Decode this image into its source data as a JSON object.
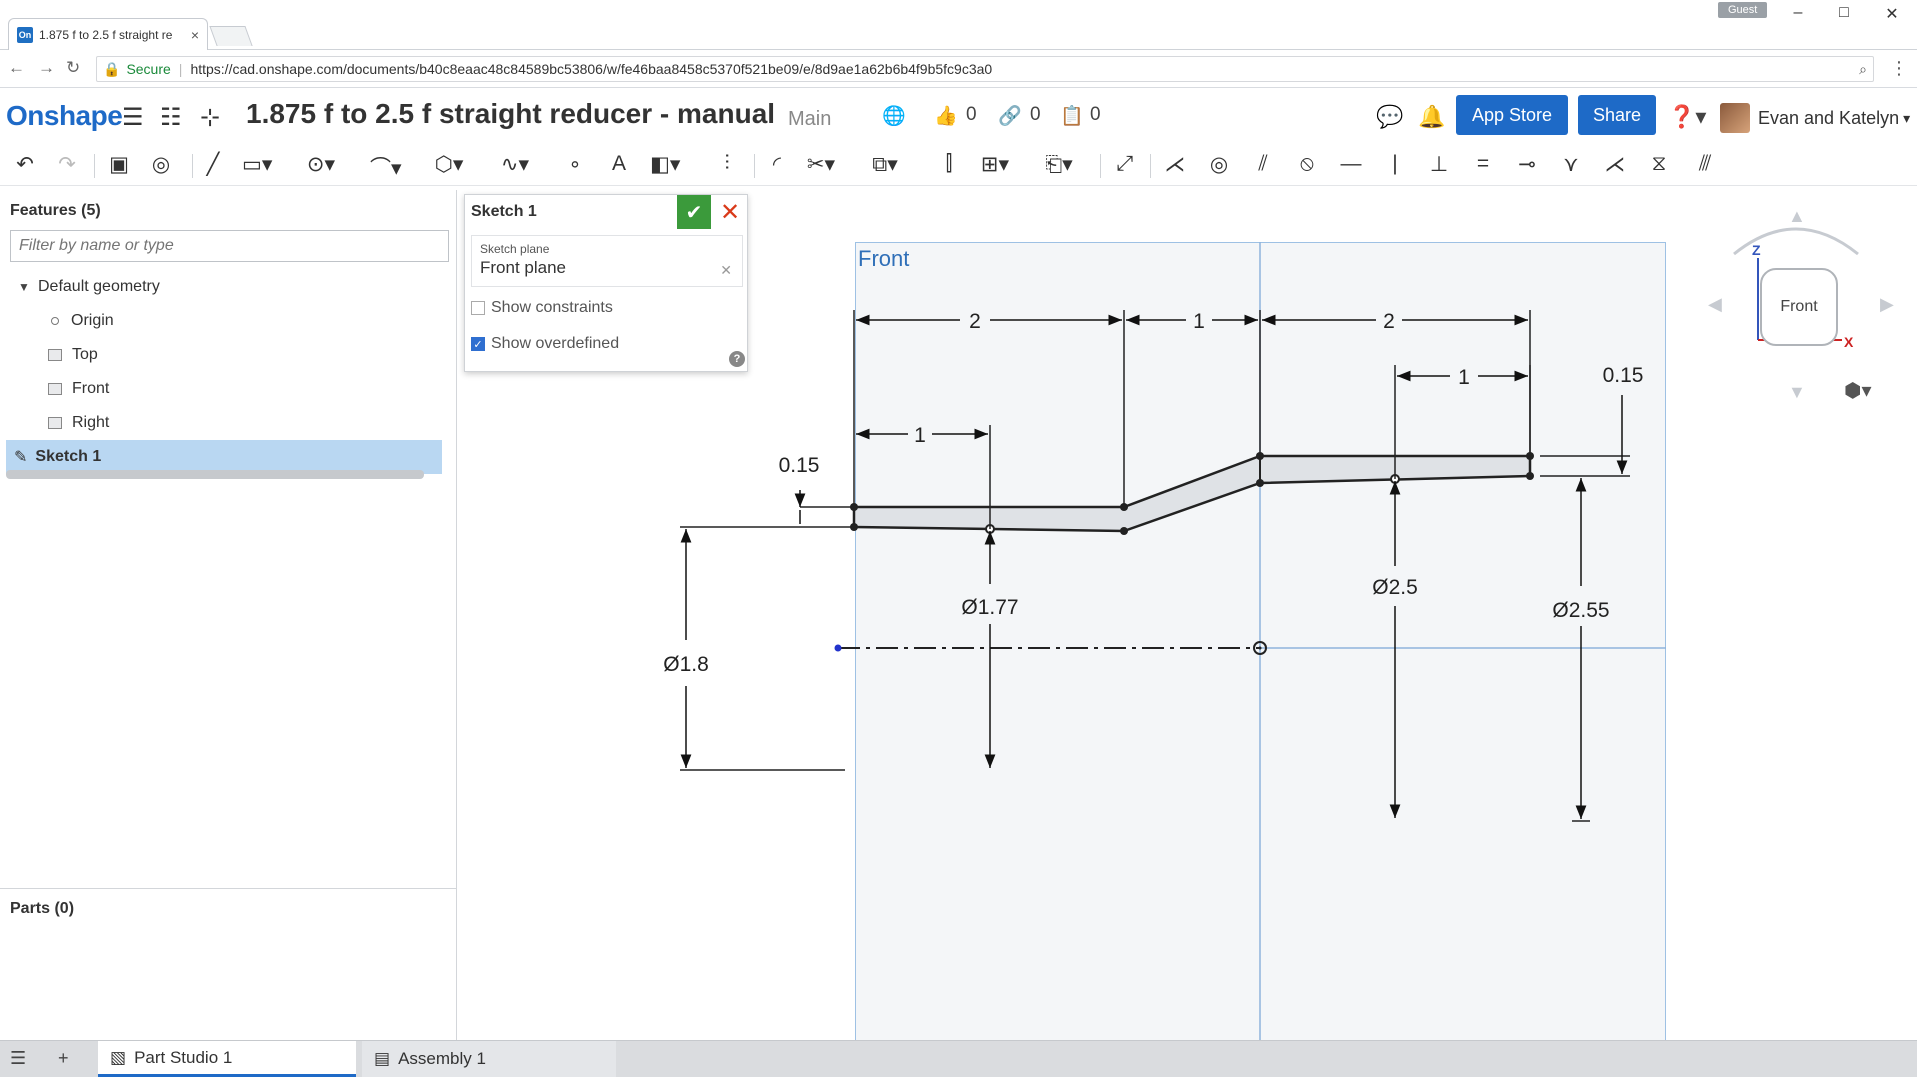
{
  "browser": {
    "tab_title": "1.875 f to 2.5 f straight re",
    "tab_close": "×",
    "guest_label": "Guest",
    "secure_label": "Secure",
    "url": "https://cad.onshape.com/documents/b40c8eaac48c84589bc53806/w/fe46baa8458c5370f521be09/e/8d9ae1a62b6b4f9b5fc9c3a0"
  },
  "header": {
    "logo": "Onshape",
    "document_title": "1.875 f to 2.5 f straight reducer - manual",
    "workspace": "Main",
    "likes": "0",
    "links": "0",
    "versions": "0",
    "app_store_label": "App Store",
    "share_label": "Share",
    "user_name": "Evan and Katelyn"
  },
  "features": {
    "title": "Features (5)",
    "filter_placeholder": "Filter by name or type",
    "default_geometry": "Default geometry",
    "items": [
      {
        "label": "Origin"
      },
      {
        "label": "Top"
      },
      {
        "label": "Front"
      },
      {
        "label": "Right"
      }
    ],
    "selected_item": "Sketch 1",
    "parts_title": "Parts (0)"
  },
  "sketch_dialog": {
    "title": "Sketch 1",
    "plane_label": "Sketch plane",
    "plane_value": "Front plane",
    "show_constraints": {
      "label": "Show constraints",
      "checked": false
    },
    "show_overdefined": {
      "label": "Show overdefined",
      "checked": true
    },
    "help": "?"
  },
  "viewport": {
    "plane_name": "Front",
    "view_cube_label": "Front",
    "axis_z": "Z",
    "axis_x": "X"
  },
  "dimensions": {
    "top_left_2": "2",
    "top_mid_1": "1",
    "top_right_2": "2",
    "right_1": "1",
    "left_1": "1",
    "left_thickness": "0.15",
    "right_thickness": "0.15",
    "dia_1_8": "Ø1.8",
    "dia_1_77": "Ø1.77",
    "dia_2_5": "Ø2.5",
    "dia_2_55": "Ø2.55"
  },
  "bottom_tabs": [
    {
      "label": "Part Studio 1",
      "active": true
    },
    {
      "label": "Assembly 1",
      "active": false
    }
  ],
  "colors": {
    "brand": "#1e6ac7",
    "ok_green": "#3b9a3b",
    "cancel_red": "#d93a1a",
    "selection": "#b9d7f2"
  }
}
